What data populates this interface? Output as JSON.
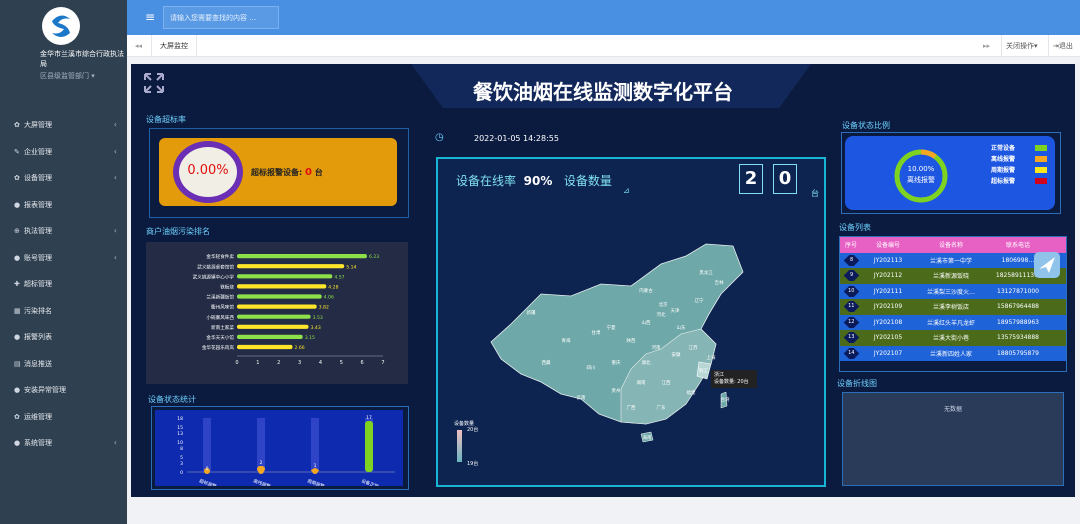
{
  "sidebar": {
    "org_name": "金华市兰溪市综合行政执法局",
    "dept": "区县级监管部门",
    "items": [
      {
        "icon": "gear-icon",
        "glyph": "✿",
        "label": "大屏管理",
        "chev": true
      },
      {
        "icon": "pin-icon",
        "glyph": "✎",
        "label": "企业管理",
        "chev": true
      },
      {
        "icon": "gear-icon",
        "glyph": "✿",
        "label": "设备管理",
        "chev": true
      },
      {
        "icon": "user-icon",
        "glyph": "●",
        "label": "报表管理",
        "chev": false
      },
      {
        "icon": "search-icon",
        "glyph": "⊕",
        "label": "执法管理",
        "chev": true
      },
      {
        "icon": "users-icon",
        "glyph": "●",
        "label": "账号管理",
        "chev": true
      },
      {
        "icon": "move-icon",
        "glyph": "✚",
        "label": "超标管理",
        "chev": false
      },
      {
        "icon": "table-icon",
        "glyph": "▦",
        "label": "污染排名",
        "chev": false
      },
      {
        "icon": "user-icon",
        "glyph": "●",
        "label": "报警列表",
        "chev": false
      },
      {
        "icon": "list-icon",
        "glyph": "▤",
        "label": "消息推送",
        "chev": false
      },
      {
        "icon": "user-icon",
        "glyph": "●",
        "label": "安装异常管理",
        "chev": false
      },
      {
        "icon": "gear-icon",
        "glyph": "✿",
        "label": "运维管理",
        "chev": false
      },
      {
        "icon": "user-icon",
        "glyph": "●",
        "label": "系统管理",
        "chev": true
      }
    ]
  },
  "topbar": {
    "search_placeholder": "请输入您需要查找的内容 …"
  },
  "tabs": {
    "active": "大屏监控",
    "close_ops": "关闭操作",
    "logout": "退出"
  },
  "dashboard": {
    "title": "餐饮油烟在线监测数字化平台",
    "datetime": "2022-01-05 14:28:55",
    "over_rate": {
      "title": "设备超标率",
      "percent": "0.00%",
      "label": "超标报警设备:",
      "count": "0",
      "unit": "台"
    },
    "online": {
      "rate_label": "设备在线率",
      "rate": "90%",
      "count_label": "设备数量",
      "digits": [
        "2",
        "0"
      ],
      "unit": "台"
    },
    "ranking_title": "商户油烟污染排名",
    "device_stats_title": "设备状态统计",
    "status_ratio": {
      "title": "设备状态比例",
      "center_pct": "10.00%",
      "center_label": "离线报警",
      "legend": [
        {
          "label": "正常设备",
          "color": "#7ed321"
        },
        {
          "label": "离线报警",
          "color": "#f5a623"
        },
        {
          "label": "周期报警",
          "color": "#f8e71c"
        },
        {
          "label": "超标报警",
          "color": "#d0021b"
        }
      ]
    },
    "device_list": {
      "title": "设备列表",
      "headers": [
        "序号",
        "设备编号",
        "设备名称",
        "联系电话"
      ],
      "rows": [
        {
          "n": "8",
          "id": "JY202113",
          "name": "兰溪市第一中学",
          "phone": "1806998…"
        },
        {
          "n": "9",
          "id": "JY202112",
          "name": "兰溪新源饭晓",
          "phone": "1825891113…"
        },
        {
          "n": "10",
          "id": "JY202111",
          "name": "兰溪梨三沙度火…",
          "phone": "13127871000"
        },
        {
          "n": "11",
          "id": "JY202109",
          "name": "兰溪李树饭店",
          "phone": "15867964488"
        },
        {
          "n": "12",
          "id": "JY202108",
          "name": "兰溪红头羊凡龙虾",
          "phone": "18957988963"
        },
        {
          "n": "13",
          "id": "JY202105",
          "name": "兰溪大街小巷",
          "phone": "13575934888"
        },
        {
          "n": "14",
          "id": "JY202107",
          "name": "兰溪新四姓人家",
          "phone": "18805795879"
        }
      ]
    },
    "linechart": {
      "title": "设备折线图",
      "empty": "无数据"
    },
    "map": {
      "legend_title": "设备数量",
      "legend_max": "20台",
      "legend_min": "19台",
      "tooltip_line1": "浙江",
      "tooltip_line2": "设备数量: 20台",
      "provinces": [
        "黑龙江",
        "吉林",
        "辽宁",
        "内蒙古",
        "新疆",
        "西藏",
        "青海",
        "甘肃",
        "宁夏",
        "陕西",
        "山西",
        "河北",
        "北京",
        "天津",
        "山东",
        "河南",
        "四川",
        "重庆",
        "湖北",
        "安徽",
        "江苏",
        "上海",
        "云南",
        "贵州",
        "湖南",
        "江西",
        "浙江",
        "福建",
        "广西",
        "广东",
        "台湾",
        "海南"
      ]
    }
  },
  "chart_data": [
    {
      "type": "bar",
      "title": "商户油烟污染排名",
      "orientation": "horizontal",
      "categories": [
        "金华轻食件卖",
        "武义姚源桌套馆馆",
        "武义姚源镇中心小学",
        "铁板烧",
        "兰溪新疆饭馆",
        "衢州风味馆",
        "小碗寨风味西",
        "新南土家菜",
        "金华天天小馆",
        "金华花园乐肉岚"
      ],
      "values": [
        6.23,
        5.14,
        4.57,
        4.28,
        4.06,
        3.82,
        3.53,
        3.43,
        3.15,
        2.66
      ],
      "xlim": [
        0,
        7
      ],
      "xticks": [
        0,
        1,
        2,
        3,
        4,
        5,
        6,
        7
      ]
    },
    {
      "type": "bar",
      "title": "设备状态统计",
      "categories": [
        "超标报警",
        "离线报警",
        "周期报警",
        "设备正常"
      ],
      "values": [
        0,
        2,
        1,
        17
      ],
      "ylim": [
        0,
        18
      ],
      "yticks": [
        0,
        3,
        5,
        8,
        10,
        13,
        15,
        18
      ]
    }
  ]
}
